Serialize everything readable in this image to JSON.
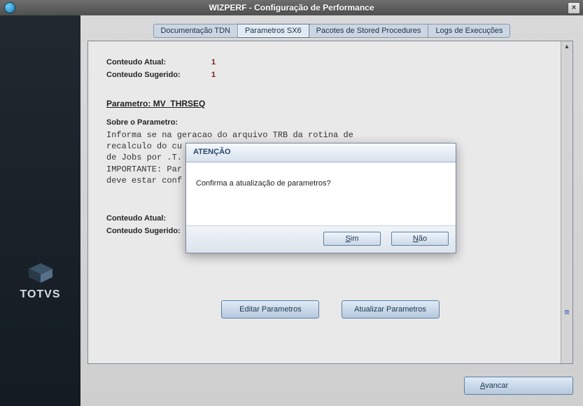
{
  "window": {
    "title": "WIZPERF - Configuração de Performance"
  },
  "brand": "TOTVS",
  "tabs": [
    {
      "label": "Documentação TDN"
    },
    {
      "label": "Parametros SX6"
    },
    {
      "label": "Pacotes de Stored Procedures"
    },
    {
      "label": "Logs de Execuções"
    }
  ],
  "current": {
    "conteudo_atual_label": "Conteudo Atual:",
    "conteudo_atual_value": "1",
    "conteudo_sugerido_label": "Conteudo Sugerido:",
    "conteudo_sugerido_value": "1"
  },
  "param": {
    "header_prefix": "Parametro:",
    "name": "MV_THRSEQ",
    "sobre_label": "Sobre o Parametro:",
    "sobre_text": "Informa se na geracao do arquivo TRB da rotina de\nrecalculo do cu\nde Jobs por .T.\nIMPORTANTE: Par\ndeve estar conf",
    "conteudo_atual_label": "Conteudo Atual:",
    "conteudo_sugerido_label": "Conteudo Sugerido:"
  },
  "buttons": {
    "editar": "Editar Parametros",
    "atualizar": "Atualizar Parametros",
    "avancar": "vancar",
    "avancar_key": "A"
  },
  "modal": {
    "title": "ATENÇÃO",
    "message": "Confirma a atualização de parametros?",
    "yes": "im",
    "yes_key": "S",
    "no": "ão",
    "no_key": "N"
  }
}
